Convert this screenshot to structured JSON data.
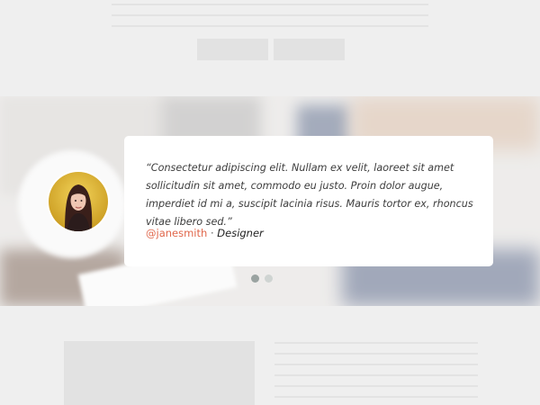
{
  "testimonial": {
    "quote": "“Consectetur adipiscing elit. Nullam ex velit, laoreet sit amet sollicitudin sit amet, commodo eu justo. Proin dolor augue, imperdiet id mi a, suscipit lacinia risus. Mauris tortor ex, rhoncus vitae libero sed.”",
    "handle": "@janesmith",
    "separator": " · ",
    "role": "Designer",
    "handle_color": "#e0664a"
  },
  "carousel": {
    "slide_count": 2,
    "active_slide": 1
  },
  "icons": {
    "avatar": "portrait-photo"
  }
}
